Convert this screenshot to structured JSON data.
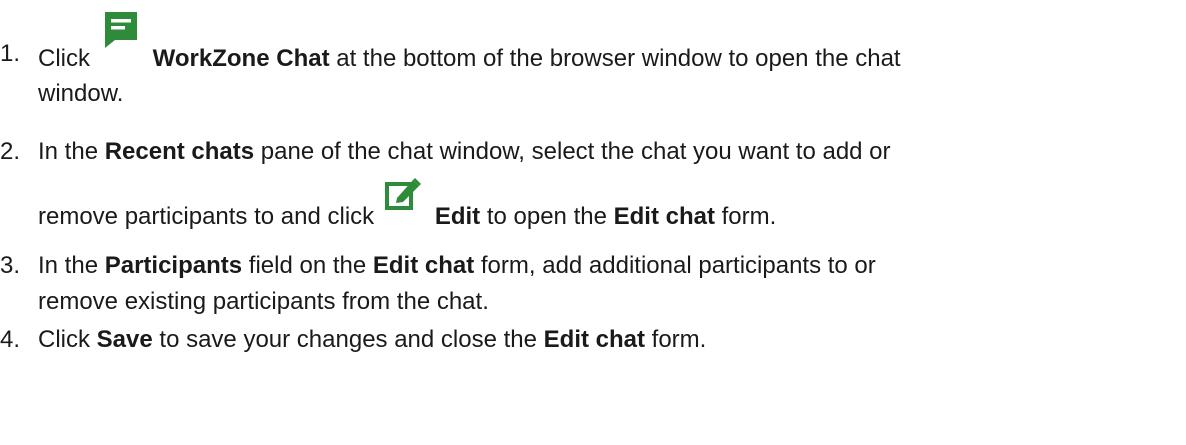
{
  "steps": [
    {
      "number": "1.",
      "line1_before": "Click ",
      "icon": "chat-icon",
      "line1_bold": "WorkZone Chat",
      "line1_after": " at the bottom of the browser window to open the chat",
      "line2": "window."
    },
    {
      "number": "2.",
      "line1_before": "In the ",
      "line1_bold": "Recent chats",
      "line1_after": " pane of the chat window, select the chat you want to add or",
      "line2_before": "remove participants to and click ",
      "icon": "edit-icon",
      "line2_bold1": "Edit",
      "line2_mid": " to open the ",
      "line2_bold2": "Edit chat",
      "line2_after": " form."
    },
    {
      "number": "3.",
      "line1_before": "In the ",
      "line1_bold1": "Participants",
      "line1_mid": " field on the ",
      "line1_bold2": "Edit chat",
      "line1_after": " form, add additional participants to or",
      "line2": "remove existing participants from the chat."
    },
    {
      "number": "4.",
      "line1_before": "Click ",
      "line1_bold1": "Save",
      "line1_mid": " to save your changes and close the ",
      "line1_bold2": "Edit chat",
      "line1_after": " form."
    }
  ],
  "colors": {
    "text": "#1a1a1a",
    "icon_green": "#2e8b3a"
  }
}
